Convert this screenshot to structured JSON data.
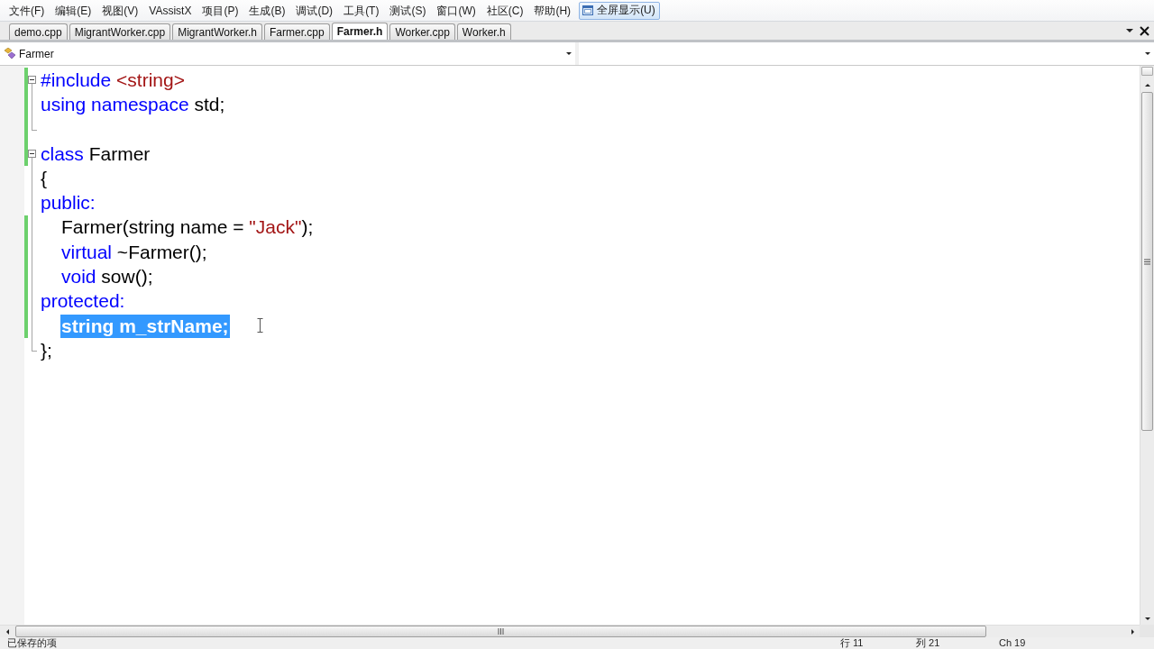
{
  "menu_bar": {
    "items": [
      "文件(F)",
      "编辑(E)",
      "视图(V)",
      "VAssistX",
      "项目(P)",
      "生成(B)",
      "调试(D)",
      "工具(T)",
      "测试(S)",
      "窗口(W)",
      "社区(C)",
      "帮助(H)"
    ],
    "fullscreen_button": {
      "label": "全屏显示(U)",
      "checked": true
    }
  },
  "tabs": [
    {
      "label": "demo.cpp",
      "selected": false
    },
    {
      "label": "MigrantWorker.cpp",
      "selected": false
    },
    {
      "label": "MigrantWorker.h",
      "selected": false
    },
    {
      "label": "Farmer.cpp",
      "selected": false
    },
    {
      "label": "Farmer.h",
      "selected": true
    },
    {
      "label": "Worker.cpp",
      "selected": false
    },
    {
      "label": "Worker.h",
      "selected": false
    }
  ],
  "navigation": {
    "class_dropdown": {
      "value": "Farmer"
    }
  },
  "editor": {
    "blocks": [
      {
        "expanded": true,
        "lines": [
          {
            "tokens": [
              {
                "kind": "keyword",
                "text": "#include"
              },
              {
                "kind": "string",
                "text": " <string>"
              }
            ],
            "changed": true,
            "selected": false
          },
          {
            "tokens": [
              {
                "kind": "keyword",
                "text": "using namespace"
              },
              {
                "kind": "plain",
                "text": " std;"
              }
            ],
            "changed": true,
            "selected": false
          },
          {
            "changed": true,
            "selected": false
          }
        ]
      },
      {
        "expanded": true,
        "lines": [
          {
            "tokens": [
              {
                "kind": "keyword",
                "text": "class"
              },
              {
                "kind": "plain",
                "text": " Farmer"
              }
            ],
            "changed": true,
            "selected": false
          },
          {
            "tokens": [
              {
                "kind": "plain",
                "text": "{"
              }
            ],
            "changed": false,
            "selected": false
          },
          {
            "tokens": [
              {
                "kind": "keyword",
                "text": "public:"
              }
            ],
            "changed": false,
            "selected": false,
            "children": [
              {
                "tokens": [
                  {
                    "kind": "plain",
                    "text": "Farmer(string name = "
                  },
                  {
                    "kind": "string",
                    "text": "\"Jack\""
                  },
                  {
                    "kind": "plain",
                    "text": ");"
                  }
                ],
                "changed": true,
                "selected": false
              },
              {
                "tokens": [
                  {
                    "kind": "keyword",
                    "text": "virtual"
                  },
                  {
                    "kind": "plain",
                    "text": " ~Farmer();"
                  }
                ],
                "changed": true,
                "selected": false
              },
              {
                "tokens": [
                  {
                    "kind": "keyword",
                    "text": "void"
                  },
                  {
                    "kind": "plain",
                    "text": " sow();"
                  }
                ],
                "changed": true,
                "selected": false
              }
            ]
          },
          {
            "tokens": [
              {
                "kind": "keyword",
                "text": "protected:"
              }
            ],
            "changed": true,
            "selected": false,
            "children": [
              {
                "tokens": [
                  {
                    "kind": "plain",
                    "text": "string m_strName;"
                  }
                ],
                "changed": true,
                "selected": true
              }
            ]
          },
          {
            "tokens": [
              {
                "kind": "plain",
                "text": "};"
              }
            ],
            "changed": false,
            "selected": false
          }
        ]
      }
    ]
  },
  "status_bar": {
    "message": "已保存的项",
    "line": "行 11",
    "column": "列 21",
    "character": "Ch 19"
  }
}
